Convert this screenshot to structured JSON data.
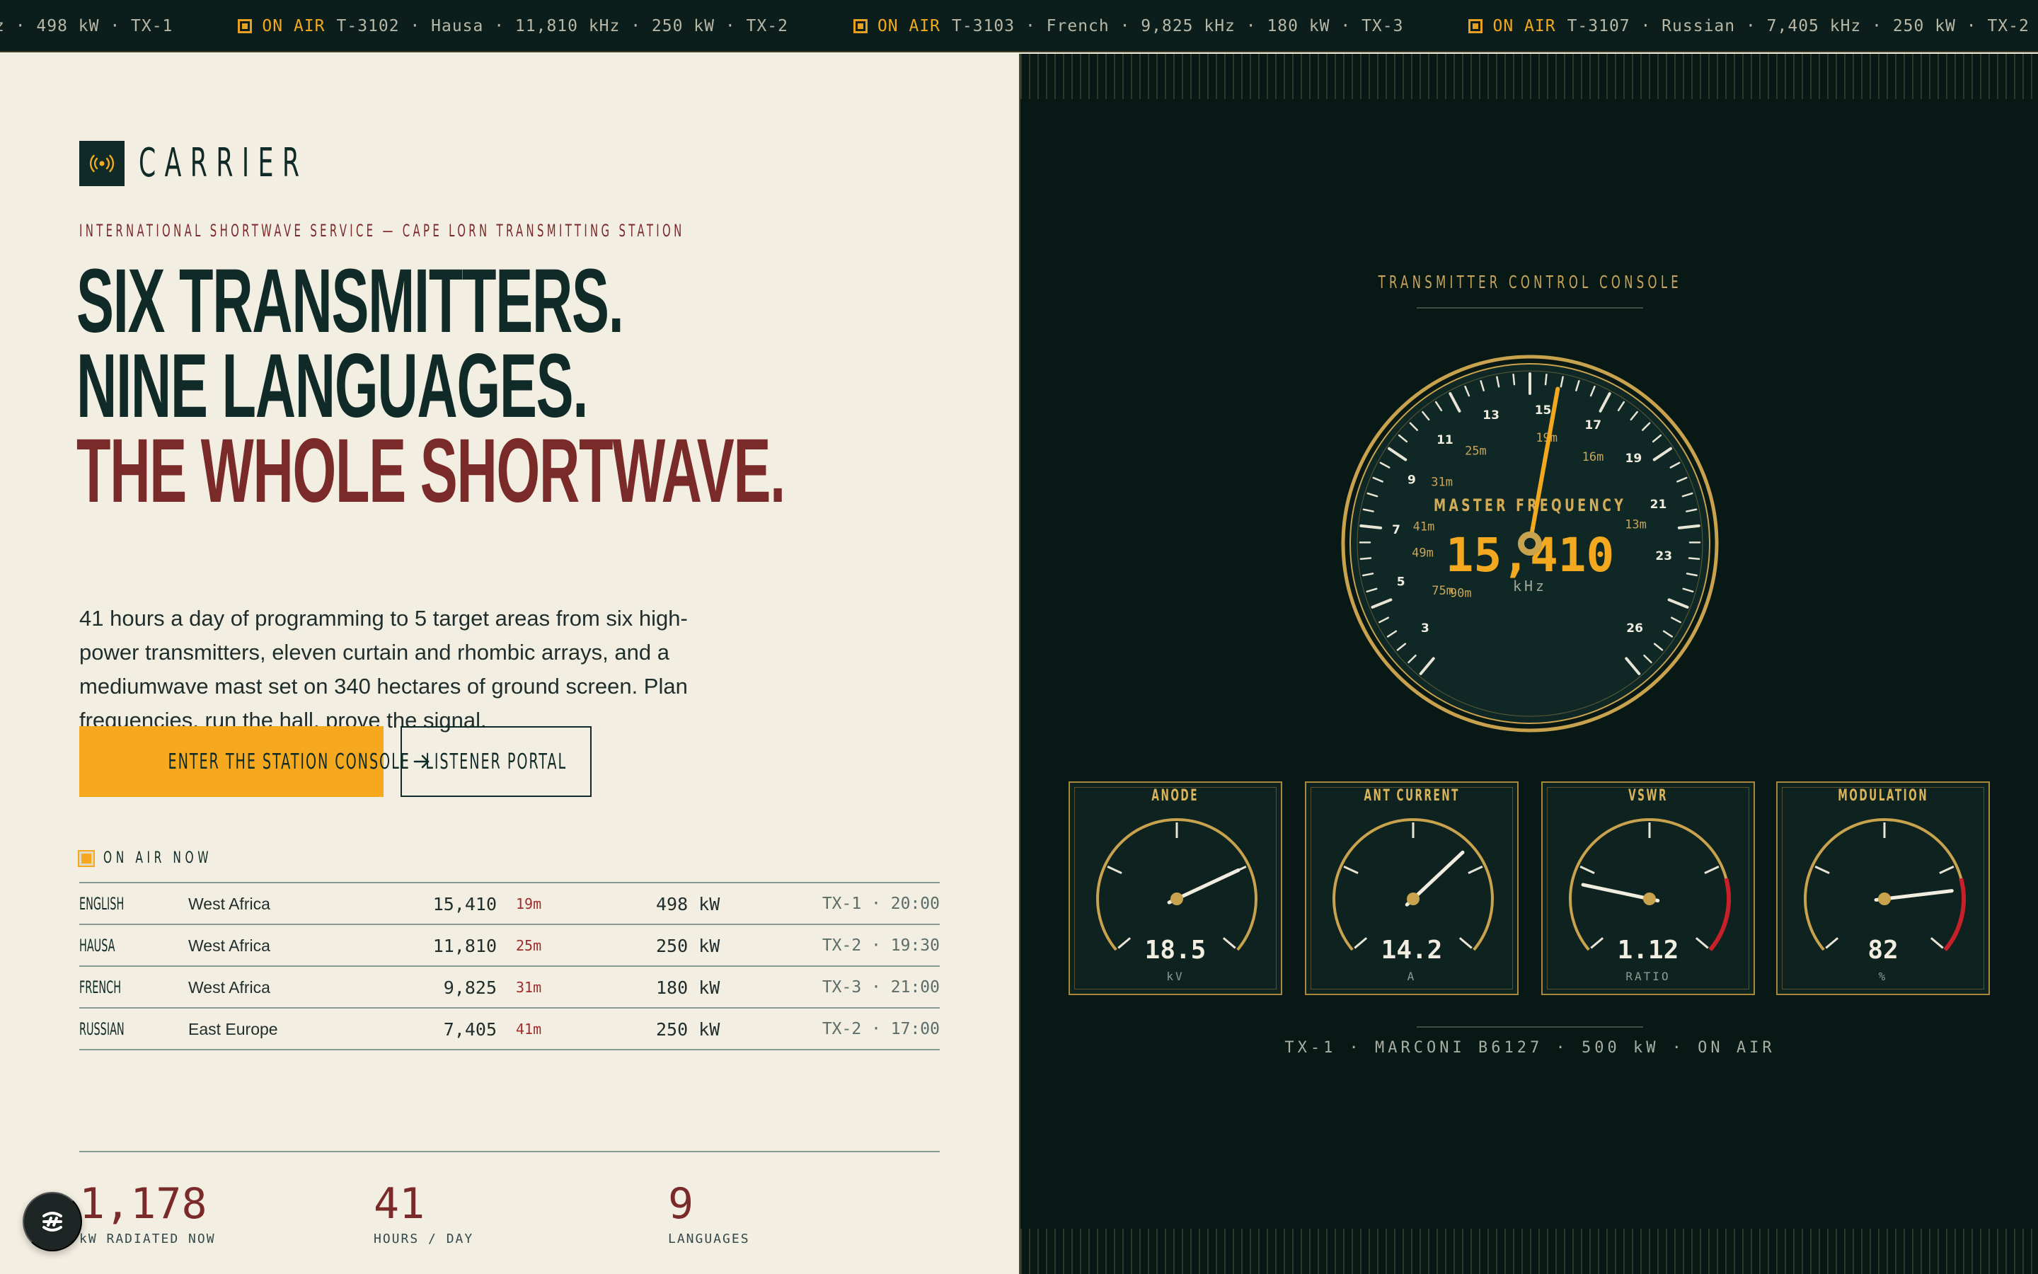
{
  "ticker": {
    "items": [
      {
        "status": "",
        "text": "z · 498 kW · TX-1"
      },
      {
        "status": "ON AIR",
        "text": "T-3102 · Hausa · 11,810 kHz · 250 kW · TX-2"
      },
      {
        "status": "ON AIR",
        "text": "T-3103 · French · 9,825 kHz · 180 kW · TX-3"
      },
      {
        "status": "ON AIR",
        "text": "T-3107 · Russian · 7,405 kHz · 250 kW · TX-2"
      }
    ],
    "accent": "#f2a91f"
  },
  "brand": {
    "name": "CARRIER",
    "icon": "broadcast-icon"
  },
  "hero": {
    "kicker": "INTERNATIONAL SHORTWAVE SERVICE — CAPE LORN TRANSMITTING STATION",
    "line1": "SIX TRANSMITTERS.",
    "line2": "NINE LANGUAGES.",
    "line3": "THE WHOLE SHORTWAVE.",
    "lede": "41 hours a day of programming to 5 target areas from six high-power transmitters, eleven curtain and rhombic arrays, and a mediumwave mast set on 340 hectares of ground screen. Plan frequencies, run the hall, prove the signal.",
    "primary_cta": "ENTER THE STATION CONSOLE",
    "primary_icon": "arrow-right-icon",
    "secondary_cta": "LISTENER PORTAL"
  },
  "on_air": {
    "label": "ON AIR NOW",
    "rows": [
      {
        "language": "ENGLISH",
        "region": "West Africa",
        "freq": "15,410",
        "band": "19m",
        "power": "498 kW",
        "slot": "TX-1 · 20:00"
      },
      {
        "language": "HAUSA",
        "region": "West Africa",
        "freq": "11,810",
        "band": "25m",
        "power": "250 kW",
        "slot": "TX-2 · 19:30"
      },
      {
        "language": "FRENCH",
        "region": "West Africa",
        "freq": "9,825",
        "band": "31m",
        "power": "180 kW",
        "slot": "TX-3 · 21:00"
      },
      {
        "language": "RUSSIAN",
        "region": "East Europe",
        "freq": "7,405",
        "band": "41m",
        "power": "250 kW",
        "slot": "TX-2 · 17:00"
      }
    ]
  },
  "stats": [
    {
      "value": "1,178",
      "label": "kW RADIATED NOW"
    },
    {
      "value": "41",
      "label": "HOURS / DAY"
    },
    {
      "value": "9",
      "label": "LANGUAGES"
    }
  ],
  "console": {
    "title": "TRANSMITTER CONTROL CONSOLE",
    "dial": {
      "label": "MASTER FREQUENCY",
      "value": "15,410",
      "unit": "kHz",
      "frequency_mhz": 15.41,
      "scale_min": 2,
      "scale_max": 27,
      "tick_labels": [
        "3",
        "5",
        "7",
        "9",
        "11",
        "13",
        "15",
        "17",
        "19",
        "21",
        "23",
        "26"
      ],
      "bands": [
        "90m",
        "75m",
        "49m",
        "41m",
        "31m",
        "25m",
        "19m",
        "16m",
        "13m"
      ]
    },
    "gauges": [
      {
        "title": "ANODE",
        "value": "18.5",
        "unit": "kV",
        "level": 0.75,
        "redzone": false
      },
      {
        "title": "ANT CURRENT",
        "value": "14.2",
        "unit": "A",
        "level": 0.68,
        "redzone": false
      },
      {
        "title": "VSWR",
        "value": "1.12",
        "unit": "RATIO",
        "level": 0.2,
        "redzone": true
      },
      {
        "title": "MODULATION",
        "value": "82",
        "unit": "%",
        "level": 0.82,
        "redzone": true
      }
    ],
    "footer": "TX-1 · MARCONI B6127 · 500 kW · ON AIR",
    "colors": {
      "needle": "#f2a91f",
      "gauge_rim": "#c9a24e",
      "redline": "#c8202a"
    }
  }
}
